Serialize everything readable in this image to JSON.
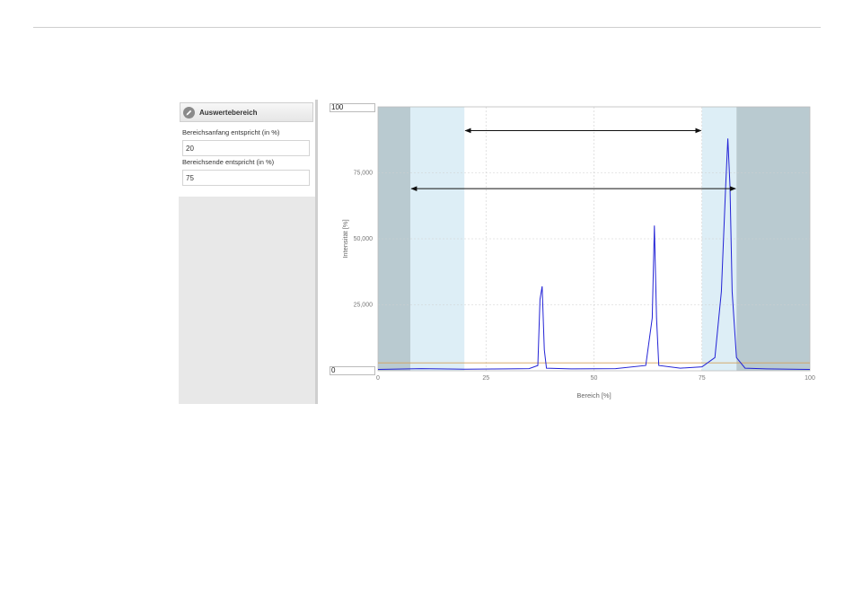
{
  "panel": {
    "title": "Auswertebereich",
    "start_label": "Bereichsanfang entspricht (in %)",
    "start_value": "20",
    "end_label": "Bereichsende entspricht (in %)",
    "end_value": "75",
    "icon": "pencil-icon"
  },
  "chart_data": {
    "type": "line",
    "xlabel": "Bereich [%]",
    "ylabel": "Intensität [%]",
    "xlim": [
      0,
      100
    ],
    "ylim": [
      0,
      100
    ],
    "xticks": [
      "0",
      "25",
      "50",
      "75",
      "100"
    ],
    "yticks": [
      "0",
      "25,000",
      "50,000",
      "75,000",
      "100"
    ],
    "ymax_box": "100",
    "ymin_box": "0",
    "grid": true,
    "series": [
      {
        "color": "#2323d6",
        "x": [
          0,
          10,
          20,
          30,
          35,
          37,
          37.5,
          38,
          38.5,
          39,
          45,
          55,
          62,
          63.5,
          64,
          64.5,
          65,
          70,
          75,
          78,
          79.5,
          80.5,
          81,
          81.5,
          82,
          83,
          85,
          90,
          100
        ],
        "y": [
          0.5,
          0.8,
          0.6,
          0.7,
          0.8,
          2,
          27,
          32,
          8,
          1,
          0.7,
          0.8,
          2,
          20,
          55,
          20,
          2,
          1,
          1.5,
          5,
          30,
          70,
          88,
          70,
          30,
          5,
          1,
          0.7,
          0.5
        ]
      }
    ],
    "threshold_line": {
      "y": 3,
      "color": "#d4a15a"
    },
    "regions": [
      {
        "from": 0,
        "to": 7.5,
        "color": "#b9cad0"
      },
      {
        "from": 7.5,
        "to": 20,
        "color": "#ddeef6"
      },
      {
        "from": 75,
        "to": 83,
        "color": "#ddeef6"
      },
      {
        "from": 83,
        "to": 100,
        "color": "#b9cad0"
      }
    ],
    "arrows": [
      {
        "from": 20,
        "to": 75,
        "y": 91
      },
      {
        "from": 7.5,
        "to": 83,
        "y": 69
      }
    ]
  }
}
